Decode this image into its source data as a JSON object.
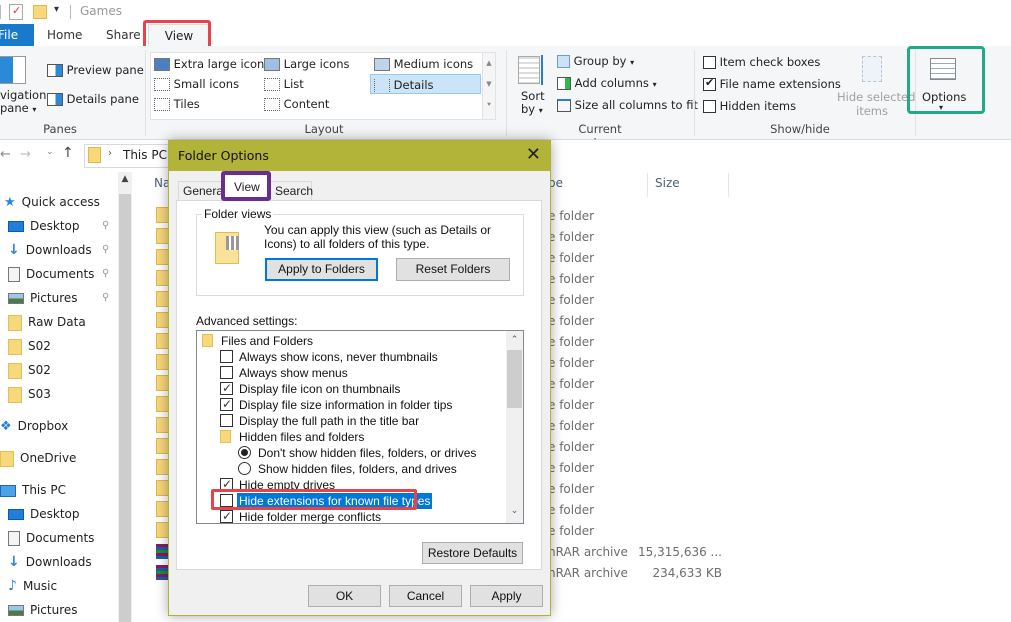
{
  "titlebar": {
    "title": "Games"
  },
  "ribbon_tabs": {
    "file": "File",
    "home": "Home",
    "share": "Share",
    "view": "View"
  },
  "panes": {
    "navigation_pane": "vigation",
    "navigation_pane_2": "pane",
    "preview_pane": "Preview pane",
    "details_pane": "Details pane",
    "group_label": "Panes"
  },
  "layout": {
    "items": [
      "Extra large icons",
      "Large icons",
      "Medium icons",
      "Small icons",
      "List",
      "Details",
      "Tiles",
      "Content"
    ],
    "selected": "Details",
    "group_label": "Layout"
  },
  "current_view": {
    "sort_by": "Sort",
    "sort_by_2": "by",
    "group_by": "Group by",
    "add_columns": "Add columns",
    "size_all": "Size all columns to fit",
    "group_label": "Current view"
  },
  "show_hide": {
    "item_check_boxes": {
      "label": "Item check boxes",
      "checked": false
    },
    "file_name_extensions": {
      "label": "File name extensions",
      "checked": true
    },
    "hidden_items": {
      "label": "Hidden items",
      "checked": false
    },
    "hide_selected": "Hide selected",
    "hide_selected_2": "items",
    "group_label": "Show/hide"
  },
  "options": {
    "label": "Options"
  },
  "address": {
    "location": "This PC"
  },
  "nav_pane": {
    "items": [
      {
        "label": "Quick access",
        "icon": "star-icon",
        "pinned": false
      },
      {
        "label": "Desktop",
        "icon": "desktop-icon",
        "pinned": true
      },
      {
        "label": "Downloads",
        "icon": "download-icon",
        "pinned": true
      },
      {
        "label": "Documents",
        "icon": "document-icon",
        "pinned": true
      },
      {
        "label": "Pictures",
        "icon": "pictures-icon",
        "pinned": true
      },
      {
        "label": "Raw Data",
        "icon": "folder-icon",
        "pinned": false
      },
      {
        "label": "S02",
        "icon": "folder-icon",
        "pinned": false
      },
      {
        "label": "S02",
        "icon": "folder-icon",
        "pinned": false
      },
      {
        "label": "S03",
        "icon": "folder-icon",
        "pinned": false
      },
      {
        "label": "Dropbox",
        "icon": "dropbox-icon",
        "pinned": false
      },
      {
        "label": "OneDrive",
        "icon": "folder-icon",
        "pinned": false
      },
      {
        "label": "This PC",
        "icon": "computer-icon",
        "pinned": false
      },
      {
        "label": "Desktop",
        "icon": "desktop-icon",
        "pinned": false
      },
      {
        "label": "Documents",
        "icon": "document-icon",
        "pinned": false
      },
      {
        "label": "Downloads",
        "icon": "download-icon",
        "pinned": false
      },
      {
        "label": "Music",
        "icon": "music-icon",
        "pinned": false
      },
      {
        "label": "Pictures",
        "icon": "pictures-icon",
        "pinned": false
      }
    ]
  },
  "file_list": {
    "columns": {
      "name": "Na",
      "type": "pe",
      "size": "Size"
    },
    "rows": [
      {
        "type": "e folder",
        "size": ""
      },
      {
        "type": "e folder",
        "size": ""
      },
      {
        "type": "e folder",
        "size": ""
      },
      {
        "type": "e folder",
        "size": ""
      },
      {
        "type": "e folder",
        "size": ""
      },
      {
        "type": "e folder",
        "size": ""
      },
      {
        "type": "e folder",
        "size": ""
      },
      {
        "type": "e folder",
        "size": ""
      },
      {
        "type": "e folder",
        "size": ""
      },
      {
        "type": "e folder",
        "size": ""
      },
      {
        "type": "e folder",
        "size": ""
      },
      {
        "type": "e folder",
        "size": ""
      },
      {
        "type": "e folder",
        "size": ""
      },
      {
        "type": "e folder",
        "size": ""
      },
      {
        "type": "e folder",
        "size": ""
      },
      {
        "type": "e folder",
        "size": ""
      },
      {
        "type": "nRAR archive",
        "size": "15,315,636 ..."
      },
      {
        "type": "nRAR archive",
        "size": "234,633 KB"
      }
    ]
  },
  "dialog": {
    "title": "Folder Options",
    "tabs": {
      "general": "General",
      "view": "View",
      "search": "Search"
    },
    "folder_views": {
      "legend": "Folder views",
      "description": "You can apply this view (such as Details or Icons) to all folders of this type.",
      "apply": "Apply to Folders",
      "reset": "Reset Folders"
    },
    "advanced_label": "Advanced settings:",
    "settings": [
      {
        "kind": "folder",
        "label": "Files and Folders",
        "level": 0
      },
      {
        "kind": "checkbox",
        "label": "Always show icons, never thumbnails",
        "checked": false,
        "level": 1
      },
      {
        "kind": "checkbox",
        "label": "Always show menus",
        "checked": false,
        "level": 1
      },
      {
        "kind": "checkbox",
        "label": "Display file icon on thumbnails",
        "checked": true,
        "level": 1
      },
      {
        "kind": "checkbox",
        "label": "Display file size information in folder tips",
        "checked": true,
        "level": 1
      },
      {
        "kind": "checkbox",
        "label": "Display the full path in the title bar",
        "checked": false,
        "level": 1
      },
      {
        "kind": "folder",
        "label": "Hidden files and folders",
        "level": 1
      },
      {
        "kind": "radio",
        "label": "Don't show hidden files, folders, or drives",
        "checked": true,
        "level": 2
      },
      {
        "kind": "radio",
        "label": "Show hidden files, folders, and drives",
        "checked": false,
        "level": 2
      },
      {
        "kind": "checkbox",
        "label": "Hide empty drives",
        "checked": true,
        "level": 1
      },
      {
        "kind": "checkbox",
        "label": "Hide extensions for known file types",
        "checked": false,
        "level": 1,
        "selected": true
      },
      {
        "kind": "checkbox",
        "label": "Hide folder merge conflicts",
        "checked": true,
        "level": 1
      }
    ],
    "restore_defaults": "Restore Defaults",
    "ok": "OK",
    "cancel": "Cancel",
    "apply": "Apply"
  },
  "annotations": {
    "red": "#e8434a",
    "purple": "#6a2c91",
    "green": "#22a98a"
  }
}
